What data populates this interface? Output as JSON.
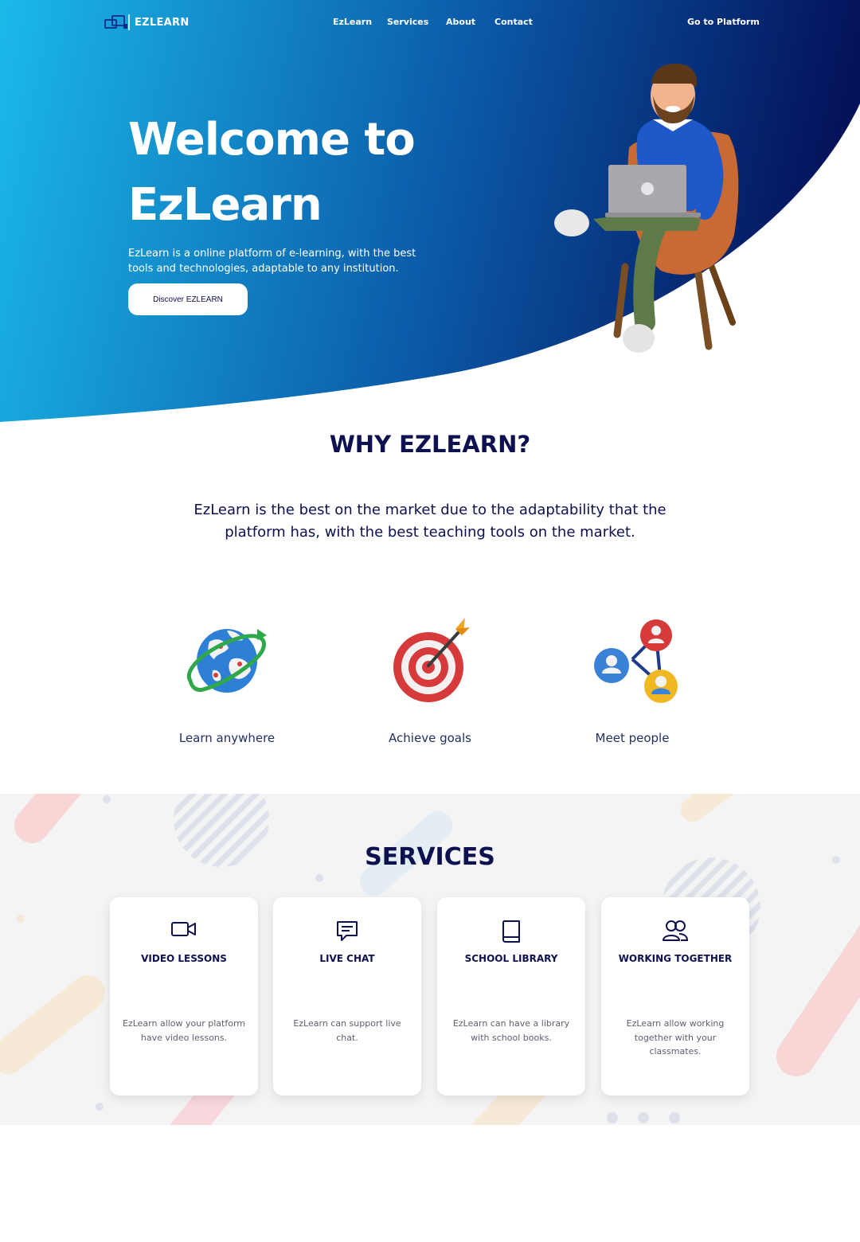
{
  "nav": {
    "logo_text": "EZLEARN",
    "links": [
      "EzLearn",
      "Services",
      "About",
      "Contact"
    ],
    "cta": "Go to Platform"
  },
  "hero": {
    "title_line1": "Welcome to",
    "title_line2": "EzLearn",
    "description": "EzLearn is a online platform of e-learning, with the best tools and technologies, adaptable to any institution.",
    "button": "Discover EZLEARN"
  },
  "why": {
    "title": "WHY EZLEARN?",
    "description": "EzLearn is the best on the market due to the adaptability that the platform has, with the best teaching tools on the market.",
    "features": [
      {
        "label": "Learn anywhere",
        "icon": "globe-icon"
      },
      {
        "label": "Achieve goals",
        "icon": "target-icon"
      },
      {
        "label": "Meet people",
        "icon": "people-network-icon"
      }
    ]
  },
  "services": {
    "title": "SERVICES",
    "cards": [
      {
        "title": "VIDEO LESSONS",
        "description": "EzLearn allow your platform have video lessons.",
        "icon": "video-camera-icon"
      },
      {
        "title": "LIVE CHAT",
        "description": "EzLearn can support live chat.",
        "icon": "chat-icon"
      },
      {
        "title": "SCHOOL LIBRARY",
        "description": "EzLearn can have a library with school books.",
        "icon": "book-icon"
      },
      {
        "title": "WORKING TOGETHER",
        "description": "EzLearn allow working together with your classmates.",
        "icon": "users-icon"
      }
    ]
  },
  "colors": {
    "hero_gradient_start": "#1ab8e8",
    "hero_gradient_mid": "#0a5aa8",
    "hero_gradient_end": "#061a5e",
    "heading": "#0d1150",
    "section_bg": "#f4f4f5"
  }
}
